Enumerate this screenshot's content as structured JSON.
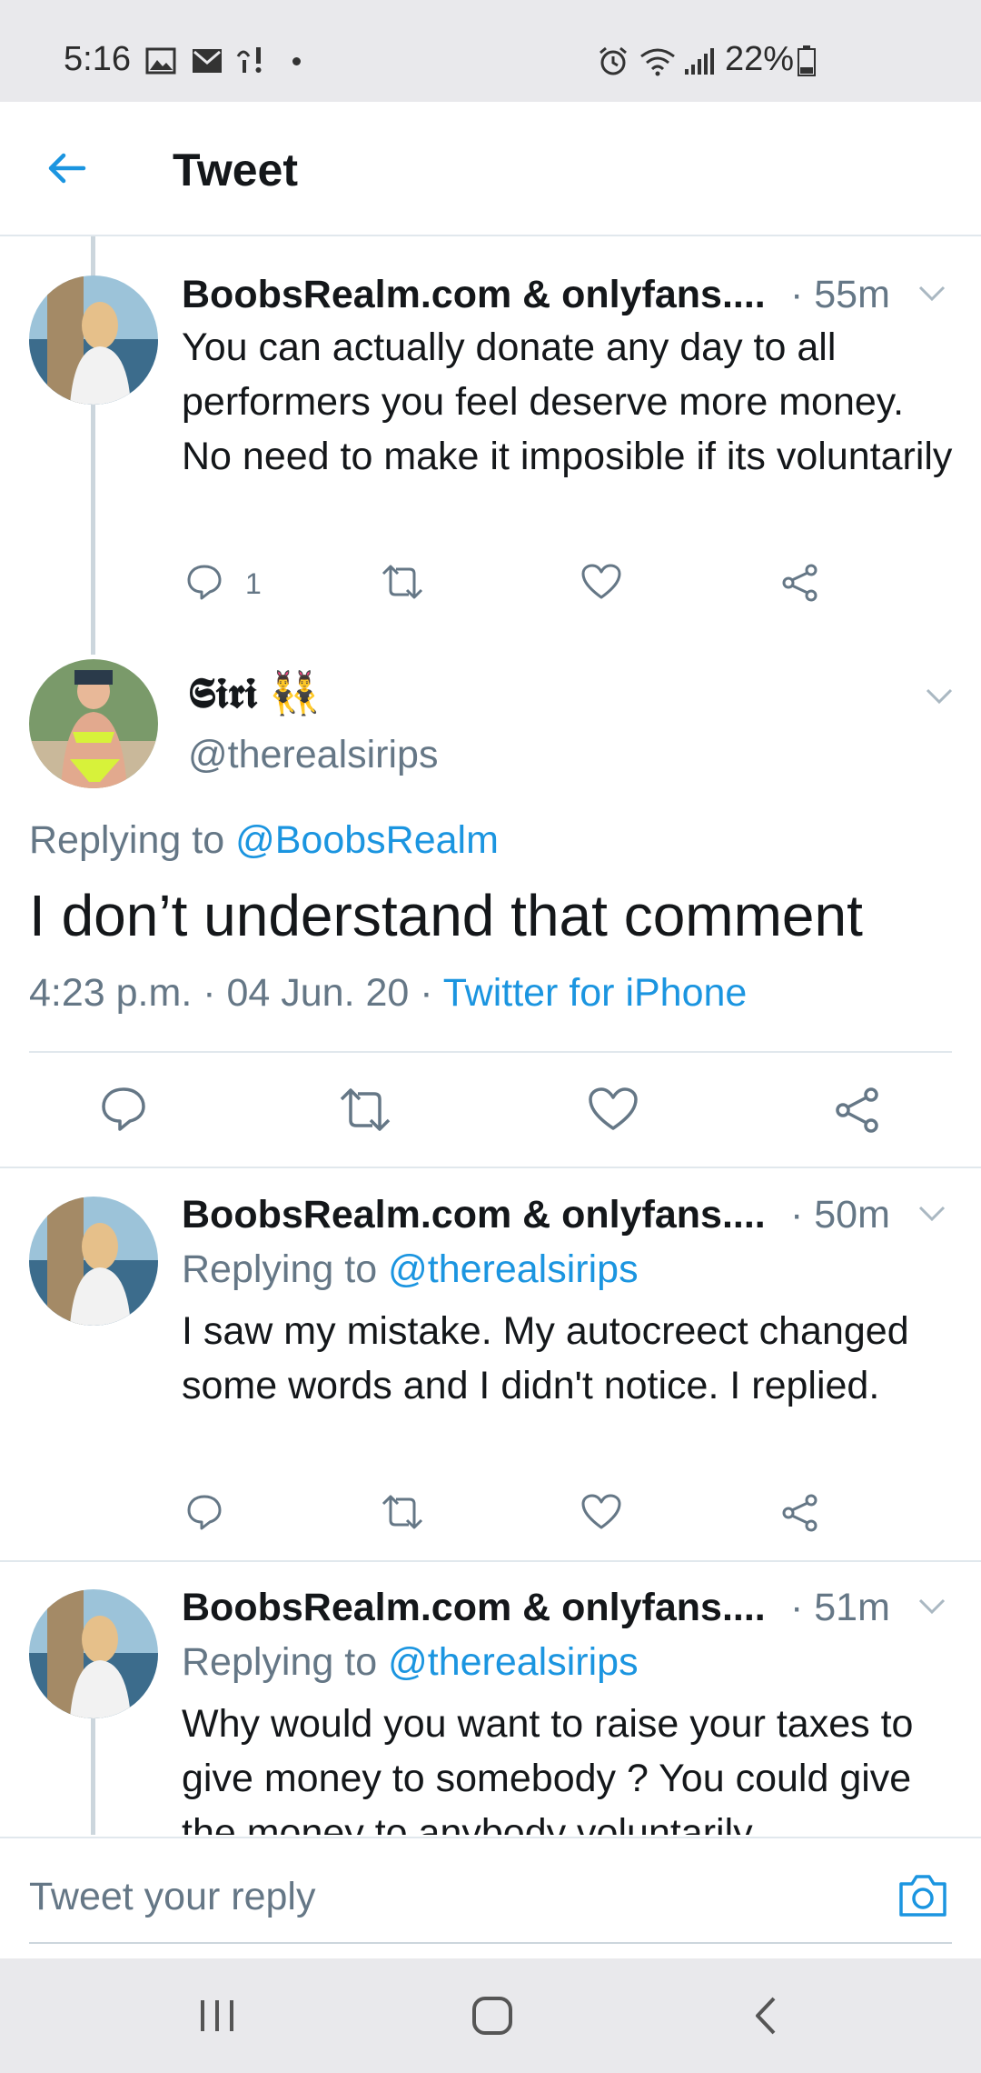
{
  "status_bar": {
    "time": "5:16",
    "battery": "22%",
    "icons": [
      "image-icon",
      "mail-icon",
      "voicemail-icon",
      "dot-icon",
      "alarm-icon",
      "wifi-icon",
      "signal-icon",
      "battery-icon"
    ]
  },
  "header": {
    "back_icon": "arrow-left-icon",
    "title": "Tweet"
  },
  "colors": {
    "accent": "#1b95e0",
    "text": "#14171a",
    "muted": "#657786",
    "divider": "#e1e8ed",
    "thread_line": "#ccd6dd"
  },
  "tweets": [
    {
      "name": "BoobsRealm.com & onlyfans....",
      "time": "· 55m",
      "text": "You can actually donate any day to all performers you feel deserve more money. No need to make it imposible if its voluntarily",
      "reply_count": "1"
    },
    {
      "name": "BoobsRealm.com & onlyfans....",
      "time": "· 50m",
      "replying_prefix": "Replying to",
      "replying_handle": "@therealsirips",
      "text": "I saw my mistake. My autocreect changed some words and I didn't notice. I replied."
    },
    {
      "name": "BoobsRealm.com & onlyfans....",
      "time": "· 51m",
      "replying_prefix": "Replying to",
      "replying_handle": "@therealsirips",
      "text": "Why would you want to raise your taxes to give money to somebody ? You could give the money to anybody voluntarily"
    }
  ],
  "main_tweet": {
    "name": "𝕾𝖎𝖗𝖎 👯‍♂️",
    "handle": "@therealsirips",
    "replying_prefix": "Replying to",
    "replying_handle": "@BoobsRealm",
    "text": "I don’t understand that comment",
    "time": "4:23 p.m. · 04 Jun. 20 ·",
    "source": "Twitter for iPhone"
  },
  "composer": {
    "placeholder": "Tweet your reply",
    "camera_icon": "camera-icon"
  },
  "nav_bar": {
    "icons": [
      "recents-icon",
      "home-icon",
      "back-icon"
    ]
  }
}
